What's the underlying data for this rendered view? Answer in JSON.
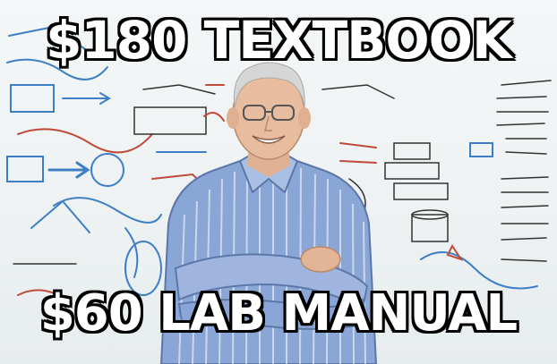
{
  "meme": {
    "top_text": "$180 TEXTBOOK",
    "bottom_text": "$60 LAB MANUAL"
  },
  "colors": {
    "whiteboard": "#eef2f3",
    "marker_blue": "#3d7fc4",
    "marker_red": "#c04a3a",
    "marker_black": "#333333",
    "shirt_blue": "#7f9ccf",
    "caption_fill": "#ffffff",
    "caption_outline": "#000000"
  }
}
